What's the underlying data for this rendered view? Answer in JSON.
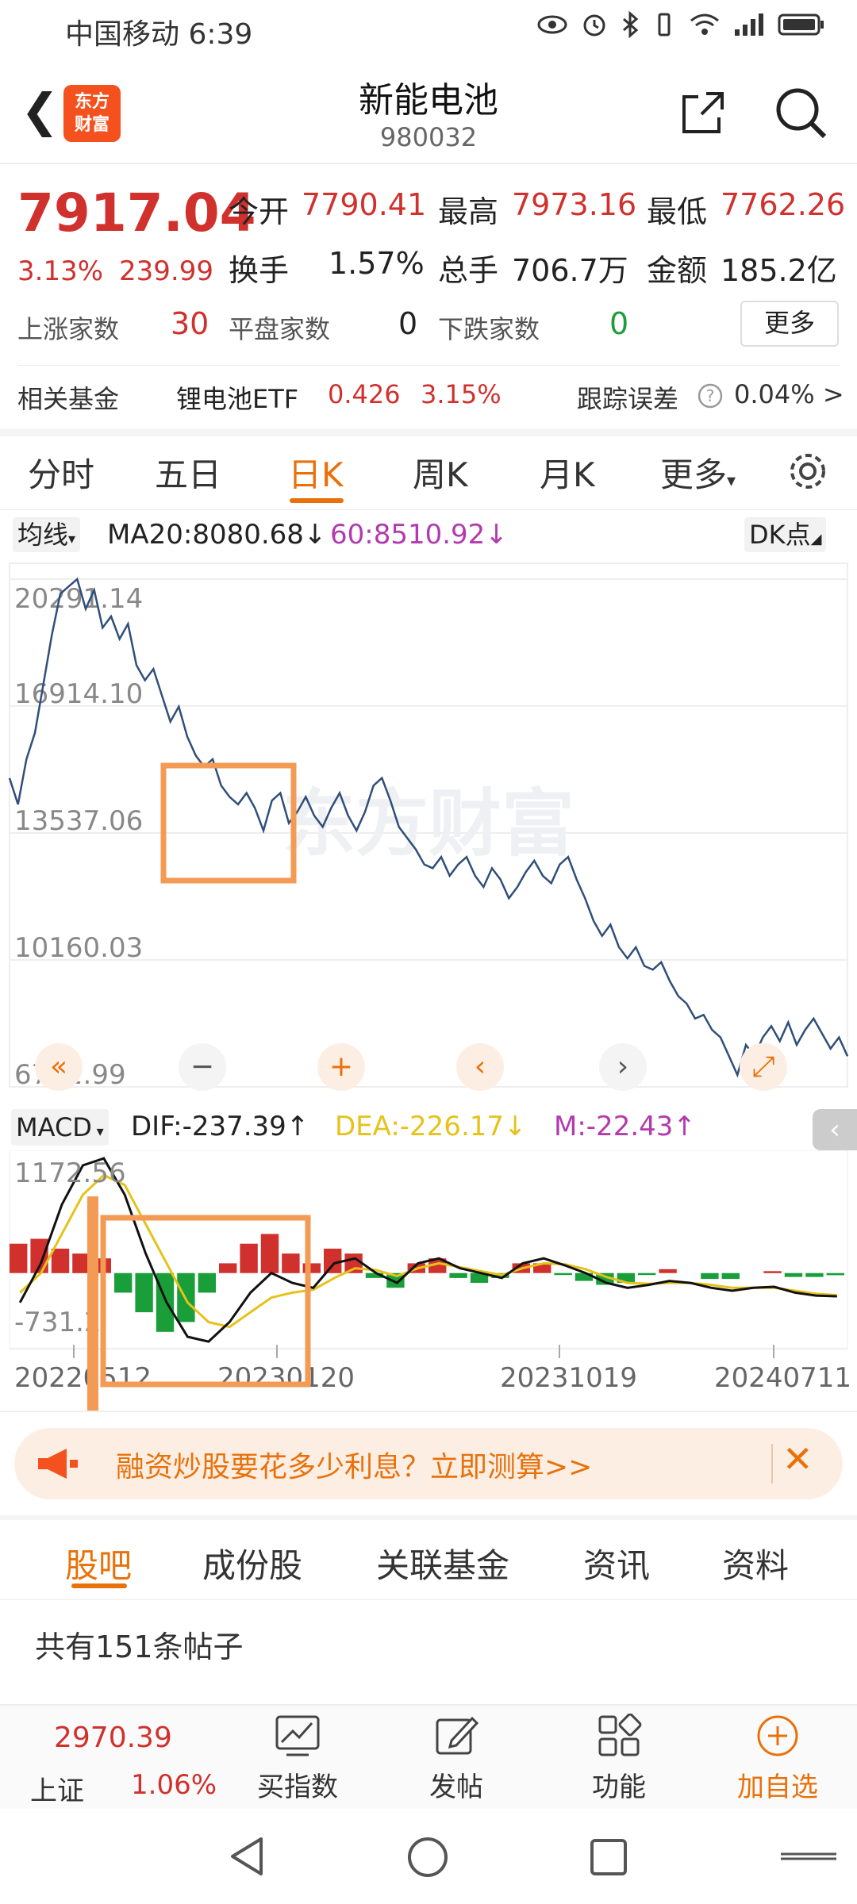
{
  "status_bar": {
    "carrier_time": "中国移动 6:39"
  },
  "header": {
    "logo": "东方财富",
    "title": "新能电池",
    "code": "980032"
  },
  "quote": {
    "price": "7917.04",
    "change_pct": "3.13%",
    "change_amt": "239.99",
    "open_label": "今开",
    "open": "7790.41",
    "high_label": "最高",
    "high": "7973.16",
    "low_label": "最低",
    "low": "7762.26",
    "turnover_label": "换手",
    "turnover": "1.57%",
    "volume_label": "总手",
    "volume": "706.7万",
    "amount_label": "金额",
    "amount": "185.2亿",
    "up_label": "上涨家数",
    "up": "30",
    "flat_label": "平盘家数",
    "flat": "0",
    "down_label": "下跌家数",
    "down": "0",
    "more_btn": "更多"
  },
  "fund": {
    "label": "相关基金",
    "name": "锂电池ETF",
    "price": "0.426",
    "pct": "3.15%",
    "track_label": "跟踪误差",
    "track_value": "0.04% >"
  },
  "tabs": [
    "分时",
    "五日",
    "日K",
    "周K",
    "月K",
    "更多"
  ],
  "chart_header": {
    "ma_select": "均线",
    "ma20": "MA20:8080.68↓",
    "ma60": "60:8510.92↓",
    "dk": "DK点"
  },
  "macd_header": {
    "select": "MACD",
    "dif": "DIF:-237.39↑",
    "dea": "DEA:-226.17↓",
    "m": "M:-22.43↑"
  },
  "colors": {
    "accent": "#e8710a",
    "up": "#d0312d",
    "down": "#1a9e3a",
    "price_line": "#2f4f7a",
    "dea": "#e6c21a",
    "m": "#b23aae"
  },
  "chart_data": [
    {
      "type": "line",
      "name": "日K price",
      "y_ticks": [
        "20291.14",
        "16914.10",
        "13537.06",
        "10160.03",
        "6782.99"
      ],
      "ylim": [
        6782.99,
        20291.14
      ],
      "watermark": "东方财富",
      "values": [
        15000,
        14300,
        15500,
        16200,
        17500,
        18800,
        19900,
        20100,
        20291,
        19500,
        20000,
        19000,
        19300,
        18700,
        19100,
        18000,
        17600,
        17900,
        17200,
        16500,
        16900,
        16100,
        15600,
        15300,
        15500,
        14800,
        14500,
        14300,
        14600,
        14200,
        13600,
        14400,
        14600,
        13800,
        14100,
        14500,
        14000,
        13700,
        14200,
        14600,
        14000,
        13600,
        14100,
        14800,
        15000,
        14400,
        13700,
        13400,
        13100,
        12700,
        12600,
        12900,
        12400,
        12700,
        12900,
        12400,
        12100,
        12600,
        12300,
        11800,
        12100,
        12500,
        12800,
        12400,
        12200,
        12700,
        12900,
        12300,
        11800,
        11200,
        10800,
        11100,
        10500,
        10200,
        10500,
        10000,
        9900,
        10100,
        9600,
        9200,
        9000,
        8600,
        8700,
        8300,
        8100,
        7600,
        7100,
        7900,
        7600,
        8100,
        8400,
        8000,
        8500,
        7900,
        8300,
        8600,
        8200,
        7800,
        8100,
        7600
      ],
      "x_labels": [
        "20220512",
        "20230120",
        "20231019",
        "20240711"
      ]
    },
    {
      "type": "bar",
      "name": "MACD",
      "y_ticks": [
        "1172.56",
        "-731.2"
      ],
      "ylim": [
        -731.2,
        1172.56
      ],
      "dif": [
        -300,
        100,
        700,
        1100,
        1172,
        800,
        200,
        -300,
        -650,
        -700,
        -500,
        -200,
        0,
        -100,
        -150,
        100,
        150,
        0,
        -100,
        100,
        150,
        50,
        0,
        -50,
        100,
        150,
        80,
        0,
        -100,
        -150,
        -120,
        -80,
        -100,
        -150,
        -180,
        -150,
        -140,
        -200,
        -230,
        -237
      ],
      "dea": [
        -200,
        0,
        400,
        800,
        1000,
        900,
        500,
        100,
        -300,
        -500,
        -550,
        -400,
        -250,
        -200,
        -170,
        -50,
        50,
        30,
        -30,
        50,
        100,
        60,
        20,
        -20,
        50,
        100,
        90,
        40,
        -40,
        -100,
        -110,
        -100,
        -100,
        -120,
        -150,
        -150,
        -150,
        -180,
        -210,
        -226
      ],
      "m": [
        300,
        350,
        250,
        200,
        150,
        -200,
        -400,
        -600,
        -500,
        -200,
        100,
        300,
        400,
        200,
        100,
        250,
        200,
        -50,
        -150,
        100,
        150,
        -50,
        -100,
        -50,
        100,
        100,
        -20,
        -80,
        -120,
        -100,
        -20,
        40,
        0,
        -60,
        -60,
        0,
        20,
        -40,
        -40,
        -22
      ]
    }
  ],
  "banner": {
    "text": "融资炒股要花多少利息？立即测算>>"
  },
  "bottom_tabs": [
    "股吧",
    "成份股",
    "关联基金",
    "资讯",
    "资料"
  ],
  "posts_count": "共有151条帖子",
  "bottom_bar": {
    "index_value": "2970.39",
    "index_name": "上证",
    "index_pct": "1.06%",
    "buy_index": "买指数",
    "post": "发帖",
    "function": "功能",
    "add": "加自选"
  }
}
